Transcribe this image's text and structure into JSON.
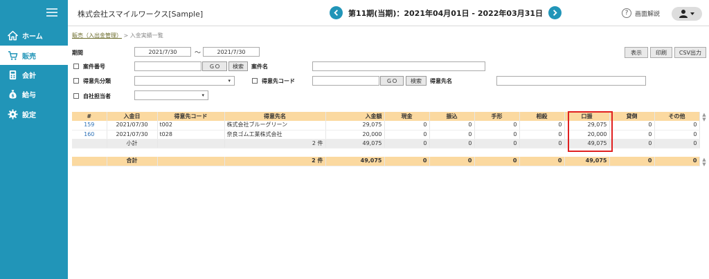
{
  "sidebar": {
    "items": [
      {
        "label": "ホーム",
        "icon": "home-icon"
      },
      {
        "label": "販売",
        "icon": "cart-icon"
      },
      {
        "label": "会計",
        "icon": "calculator-icon"
      },
      {
        "label": "給与",
        "icon": "money-bag-icon"
      },
      {
        "label": "設定",
        "icon": "gear-icon"
      }
    ],
    "active_index": 1
  },
  "header": {
    "company": "株式会社スマイルワークス[Sample]",
    "period": "第11期(当期)：2021年04月01日 - 2022年03月31日",
    "help_label": "画面解説"
  },
  "breadcrumb": {
    "parent": "販売（入出金管理）",
    "separator": ">",
    "current": "入金実績一覧"
  },
  "filters": {
    "period_label": "期間",
    "period_from": "2021/7/30",
    "period_tilde": "～",
    "period_to": "2021/7/30",
    "case_no_label": "案件番号",
    "case_name_label": "案件名",
    "customer_category_label": "得意先分類",
    "customer_code_label": "得意先コード",
    "customer_name_label": "得意先名",
    "staff_label": "自社担当者",
    "go_label": "ＧＯ",
    "search_label": "検索"
  },
  "actions": {
    "display": "表示",
    "print": "印刷",
    "csv": "CSV出力"
  },
  "table": {
    "columns": [
      "#",
      "入金日",
      "得意先コード",
      "得意先名",
      "入金額",
      "現金",
      "振込",
      "手形",
      "相殺",
      "口振",
      "貸倒",
      "その他"
    ],
    "rows": [
      [
        "159",
        "2021/07/30",
        "t002",
        "株式会社ブルーグリーン",
        "29,075",
        "0",
        "0",
        "0",
        "0",
        "29,075",
        "0",
        "0"
      ],
      [
        "160",
        "2021/07/30",
        "t028",
        "奈良ゴム工業株式会社",
        "20,000",
        "0",
        "0",
        "0",
        "0",
        "20,000",
        "0",
        "0"
      ]
    ],
    "subtotal": {
      "label": "小計",
      "count": "2 件",
      "amount": "49,075",
      "cash": "0",
      "transfer": "0",
      "bill": "0",
      "offset": "0",
      "debit": "49,075",
      "bad_debt": "0",
      "other": "0"
    },
    "total": {
      "label": "合計",
      "count": "2 件",
      "amount": "49,075",
      "cash": "0",
      "transfer": "0",
      "bill": "0",
      "offset": "0",
      "debit": "49,075",
      "bad_debt": "0",
      "other": "0"
    }
  },
  "colors": {
    "sidebar": "#2195b8",
    "table_header": "#fbd9a0",
    "highlight": "#e02020"
  }
}
